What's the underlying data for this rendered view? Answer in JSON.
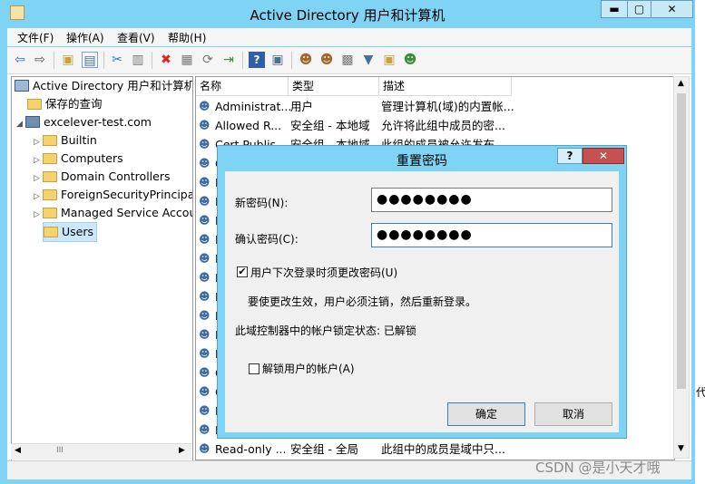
{
  "window": {
    "title": "Active Directory 用户和计算机",
    "controls": {
      "minimize": "▬",
      "maximize": "▢",
      "close": "✕"
    }
  },
  "menubar": [
    "文件(F)",
    "操作(A)",
    "查看(V)",
    "帮助(H)"
  ],
  "toolbar": {
    "icons": [
      "back-icon",
      "forward-icon",
      "up-folder-icon",
      "show-tree-icon",
      "cut-icon",
      "paste-icon",
      "delete-icon",
      "properties-icon",
      "refresh-icon",
      "export-icon",
      "help-icon",
      "console-icon",
      "add-user-icon",
      "add-group-icon",
      "add-ou-icon",
      "filter-icon",
      "find-icon",
      "add-to-group-icon"
    ]
  },
  "tree": {
    "root": "Active Directory 用户和计算机",
    "items": [
      {
        "label": "保存的查询",
        "indent": 1,
        "twisty": ""
      },
      {
        "label": "excelever-test.com",
        "indent": 1,
        "twisty": "◢"
      },
      {
        "label": "Builtin",
        "indent": 2,
        "twisty": "▷"
      },
      {
        "label": "Computers",
        "indent": 2,
        "twisty": "▷"
      },
      {
        "label": "Domain Controllers",
        "indent": 2,
        "twisty": "▷"
      },
      {
        "label": "ForeignSecurityPrincipals",
        "indent": 2,
        "twisty": "▷"
      },
      {
        "label": "Managed Service Accounts",
        "indent": 2,
        "twisty": "▷"
      },
      {
        "label": "Users",
        "indent": 2,
        "twisty": ""
      }
    ],
    "selected": "Users",
    "hscroll_glyph": "III"
  },
  "list": {
    "columns": [
      "名称",
      "类型",
      "描述"
    ],
    "rows": [
      {
        "name": "Administrat...",
        "type": "用户",
        "desc": "管理计算机(域)的内置帐..."
      },
      {
        "name": "Allowed R...",
        "type": "安全组 - 本地域",
        "desc": "允许将此组中成员的密..."
      },
      {
        "name": "Cert Publis...",
        "type": "安全组 - 本地域",
        "desc": "此组的成员被允许发布..."
      },
      {
        "name": "C",
        "type": "",
        "desc": ""
      },
      {
        "name": "D",
        "type": "",
        "desc": ""
      },
      {
        "name": "D",
        "type": "",
        "desc": ""
      },
      {
        "name": "D",
        "type": "",
        "desc": ""
      },
      {
        "name": "D",
        "type": "",
        "desc": ""
      },
      {
        "name": "D",
        "type": "",
        "desc": ""
      },
      {
        "name": "D",
        "type": "",
        "desc": ""
      },
      {
        "name": "D",
        "type": "",
        "desc": ""
      },
      {
        "name": "D",
        "type": "",
        "desc": ""
      },
      {
        "name": "E",
        "type": "",
        "desc": ""
      },
      {
        "name": "E",
        "type": "",
        "desc": ""
      },
      {
        "name": "G",
        "type": "",
        "desc": ""
      },
      {
        "name": "G",
        "type": "",
        "desc": ""
      },
      {
        "name": "P",
        "type": "",
        "desc": ""
      },
      {
        "name": "R",
        "type": "",
        "desc": ""
      },
      {
        "name": "Read-only ...",
        "type": "安全组 - 全局",
        "desc": "此组中的成员是域中只..."
      }
    ]
  },
  "dialog": {
    "title": "重置密码",
    "help": "?",
    "close": "✕",
    "new_password_label": "新密码(N):",
    "new_password_value": "●●●●●●●●",
    "confirm_password_label": "确认密码(C):",
    "confirm_password_value": "●●●●●●●●",
    "must_change_label": "用户下次登录时须更改密码(U)",
    "must_change_checked": true,
    "info_text": "要使更改生效，用户必须注销，然后重新登录。",
    "lock_status_text": "此域控制器中的帐户锁定状态: 已解锁",
    "unlock_label": "解锁用户的帐户(A)",
    "unlock_checked": false,
    "ok": "确定",
    "cancel": "取消"
  },
  "watermark": "CSDN @是小天才哦",
  "side_text": "代"
}
